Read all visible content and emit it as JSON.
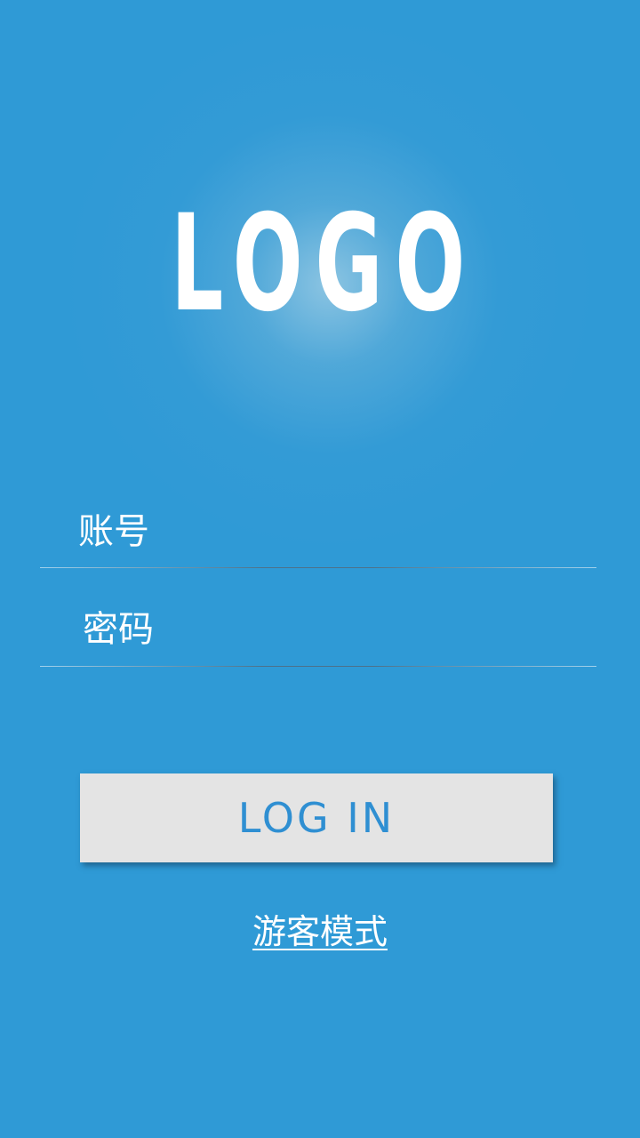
{
  "logo": {
    "text": "LOGO"
  },
  "login_form": {
    "account_placeholder": "账号",
    "password_placeholder": "密码",
    "login_button_label": "LOG IN",
    "guest_mode_link": "游客模式"
  },
  "colors": {
    "background": "#2f9ad6",
    "button_background": "#e4e4e4",
    "button_text": "#2f8fd2",
    "text": "#ffffff"
  }
}
